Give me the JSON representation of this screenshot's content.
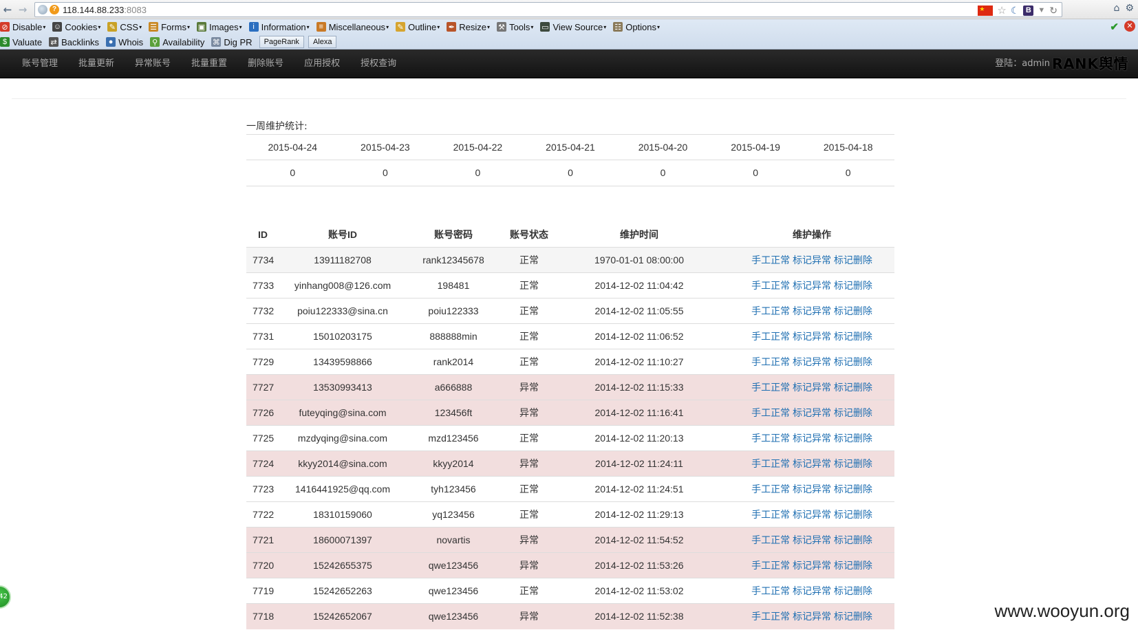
{
  "browser": {
    "url_host": "118.144.88.233",
    "url_port": ":8083"
  },
  "toolbar": {
    "row1": [
      {
        "label": "Disable",
        "icon": "disable-icon",
        "caret": true,
        "color": "#d43b2a"
      },
      {
        "label": "Cookies",
        "icon": "user-icon",
        "caret": true,
        "color": "#444444"
      },
      {
        "label": "CSS",
        "icon": "pencil-icon",
        "caret": true,
        "color": "#c9a227"
      },
      {
        "label": "Forms",
        "icon": "clipboard-icon",
        "caret": true,
        "color": "#c98a27"
      },
      {
        "label": "Images",
        "icon": "image-icon",
        "caret": true,
        "color": "#5a7a3a"
      },
      {
        "label": "Information",
        "icon": "info-icon",
        "caret": true,
        "color": "#2a6ec0"
      },
      {
        "label": "Miscellaneous",
        "icon": "book-icon",
        "caret": true,
        "color": "#c97a27"
      },
      {
        "label": "Outline",
        "icon": "pencil-icon",
        "caret": true,
        "color": "#d6a530"
      },
      {
        "label": "Resize",
        "icon": "pen-icon",
        "caret": true,
        "color": "#b8542a"
      },
      {
        "label": "Tools",
        "icon": "wrench-icon",
        "caret": true,
        "color": "#777777"
      },
      {
        "label": "View Source",
        "icon": "monitor-icon",
        "caret": true,
        "color": "#3d4a3d"
      },
      {
        "label": "Options",
        "icon": "options-icon",
        "caret": true,
        "color": "#8a7a5a"
      }
    ],
    "row2": [
      {
        "label": "Valuate",
        "icon": "dollar-icon",
        "color": "#2c8a2c"
      },
      {
        "label": "Backlinks",
        "icon": "swap-icon",
        "color": "#555555"
      },
      {
        "label": "Whois",
        "icon": "globe-icon",
        "color": "#3a6fb0"
      },
      {
        "label": "Availability",
        "icon": "search-icon",
        "color": "#5aa03a"
      },
      {
        "label": "Dig PR",
        "icon": "network-icon",
        "color": "#7a8aa0"
      }
    ],
    "buttons": [
      "PageRank",
      "Alexa"
    ]
  },
  "nav": {
    "links": [
      "账号管理",
      "批量更新",
      "异常账号",
      "批量重置",
      "删除账号",
      "应用授权",
      "授权查询"
    ],
    "login": "登陆：admin",
    "brand": "RANK舆情"
  },
  "stats": {
    "title": "一周维护统计:",
    "dates": [
      "2015-04-24",
      "2015-04-23",
      "2015-04-22",
      "2015-04-21",
      "2015-04-20",
      "2015-04-19",
      "2015-04-18"
    ],
    "counts": [
      "0",
      "0",
      "0",
      "0",
      "0",
      "0",
      "0"
    ]
  },
  "accounts": {
    "headers": [
      "ID",
      "账号ID",
      "账号密码",
      "账号状态",
      "维护时间",
      "维护操作"
    ],
    "actions": [
      "手工正常",
      "标记异常",
      "标记删除"
    ],
    "rows": [
      {
        "id": "7734",
        "account": "13911182708",
        "password": "rank12345678",
        "status": "正常",
        "time": "1970-01-01 08:00:00",
        "error": false
      },
      {
        "id": "7733",
        "account": "yinhang008@126.com",
        "password": "198481",
        "status": "正常",
        "time": "2014-12-02 11:04:42",
        "error": false
      },
      {
        "id": "7732",
        "account": "poiu122333@sina.cn",
        "password": "poiu122333",
        "status": "正常",
        "time": "2014-12-02 11:05:55",
        "error": false
      },
      {
        "id": "7731",
        "account": "15010203175",
        "password": "888888min",
        "status": "正常",
        "time": "2014-12-02 11:06:52",
        "error": false
      },
      {
        "id": "7729",
        "account": "13439598866",
        "password": "rank2014",
        "status": "正常",
        "time": "2014-12-02 11:10:27",
        "error": false
      },
      {
        "id": "7727",
        "account": "13530993413",
        "password": "a666888",
        "status": "异常",
        "time": "2014-12-02 11:15:33",
        "error": true
      },
      {
        "id": "7726",
        "account": "futeyqing@sina.com",
        "password": "123456ft",
        "status": "异常",
        "time": "2014-12-02 11:16:41",
        "error": true
      },
      {
        "id": "7725",
        "account": "mzdyqing@sina.com",
        "password": "mzd123456",
        "status": "正常",
        "time": "2014-12-02 11:20:13",
        "error": false
      },
      {
        "id": "7724",
        "account": "kkyy2014@sina.com",
        "password": "kkyy2014",
        "status": "异常",
        "time": "2014-12-02 11:24:11",
        "error": true
      },
      {
        "id": "7723",
        "account": "1416441925@qq.com",
        "password": "tyh123456",
        "status": "正常",
        "time": "2014-12-02 11:24:51",
        "error": false
      },
      {
        "id": "7722",
        "account": "18310159060",
        "password": "yq123456",
        "status": "正常",
        "time": "2014-12-02 11:29:13",
        "error": false
      },
      {
        "id": "7721",
        "account": "18600071397",
        "password": "novartis",
        "status": "异常",
        "time": "2014-12-02 11:54:52",
        "error": true
      },
      {
        "id": "7720",
        "account": "15242655375",
        "password": "qwe123456",
        "status": "异常",
        "time": "2014-12-02 11:53:26",
        "error": true
      },
      {
        "id": "7719",
        "account": "15242652263",
        "password": "qwe123456",
        "status": "正常",
        "time": "2014-12-02 11:53:02",
        "error": false
      },
      {
        "id": "7718",
        "account": "15242652067",
        "password": "qwe123456",
        "status": "异常",
        "time": "2014-12-02 11:52:38",
        "error": true
      }
    ]
  },
  "floating_badge": "42",
  "watermark": "www.wooyun.org"
}
